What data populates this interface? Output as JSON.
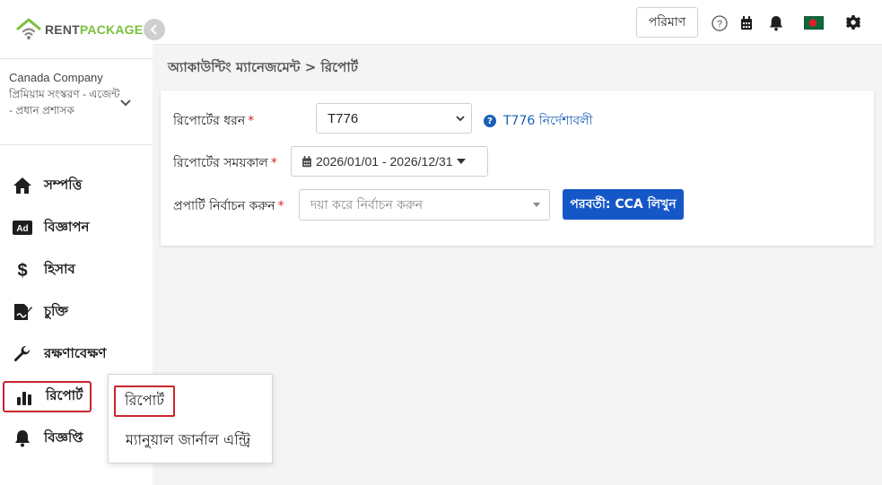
{
  "app": {
    "logo_word_1": "RENT",
    "logo_word_2": "PACKAGE"
  },
  "company": {
    "name": "Canada Company",
    "subtitle": "প্রিমিয়াম সংস্করণ - এজেন্ট - প্রধান প্রশাসক"
  },
  "sidebar": {
    "items": [
      {
        "label": "সম্পত্তি",
        "icon": "home-icon"
      },
      {
        "label": "বিজ্ঞাপন",
        "icon": "ad-icon"
      },
      {
        "label": "হিসাব",
        "icon": "dollar-icon"
      },
      {
        "label": "চুক্তি",
        "icon": "contract-icon"
      },
      {
        "label": "রক্ষণাবেক্ষণ",
        "icon": "wrench-icon"
      },
      {
        "label": "রিপোর্ট",
        "icon": "bar-chart-icon"
      },
      {
        "label": "বিজ্ঞপ্তি",
        "icon": "bell-icon"
      }
    ]
  },
  "flyout": {
    "items": [
      "রিপোর্ট",
      "ম্যানুয়াল জার্নাল এন্ট্রি"
    ]
  },
  "topbar": {
    "measure_label": "পরিমাণ"
  },
  "breadcrumb": "অ্যাকাউন্টিং ম্যানেজমেন্ট > রিপোর্ট",
  "form": {
    "report_type_label": "রিপোর্টের ধরন",
    "report_type_value": "T776",
    "help_link": "T776 নির্দেশাবলী",
    "period_label": "রিপোর্টের সময়কাল",
    "period_value": "2026/01/01 - 2026/12/31",
    "property_label": "প্রপার্টি নির্বাচন করুন",
    "property_placeholder": "দয়া করে নির্বাচন করুন",
    "next_button": "পরবর্তী: CCA লিখুন",
    "required_mark": "*"
  },
  "colors": {
    "accent": "#1557c7",
    "logo_green": "#7cbf3c",
    "highlight_red": "#c8262c"
  }
}
